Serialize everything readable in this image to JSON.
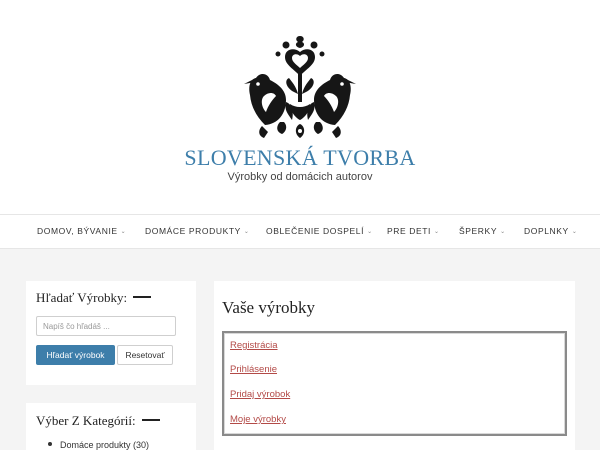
{
  "site": {
    "title": "SLOVENSKÁ TVORBA",
    "tagline": "Výrobky od domácich autorov",
    "logo_icon": "folk-birds-heart-logo-icon"
  },
  "colors": {
    "accent": "#3d7eaa",
    "link": "#b34a47",
    "background": "#f4f4f4"
  },
  "nav": {
    "items": [
      {
        "label": "DOMOV, BÝVANIE",
        "icon": "chevron-down-icon"
      },
      {
        "label": "DOMÁCE PRODUKTY",
        "icon": "chevron-down-icon"
      },
      {
        "label": "OBLEČENIE DOSPELÍ",
        "icon": "chevron-down-icon"
      },
      {
        "label": "PRE DETI",
        "icon": "chevron-down-icon"
      },
      {
        "label": "ŠPERKY",
        "icon": "chevron-down-icon"
      },
      {
        "label": "DOPLNKY",
        "icon": "chevron-down-icon"
      }
    ]
  },
  "sidebar": {
    "search": {
      "title": "Hľadať Výrobky:",
      "placeholder": "Napíš čo hľadáš ...",
      "value": "",
      "submit_label": "Hľadať výrobok",
      "reset_label": "Resetovať"
    },
    "categories": {
      "title": "Výber Z Kategórií:",
      "items": [
        {
          "label": "Domáce produkty (30)"
        }
      ]
    }
  },
  "main": {
    "title": "Vaše výrobky",
    "links": [
      {
        "label": "Registrácia"
      },
      {
        "label": "Prihlásenie"
      },
      {
        "label": "Pridaj výrobok"
      },
      {
        "label": "Moje výrobky"
      }
    ]
  }
}
